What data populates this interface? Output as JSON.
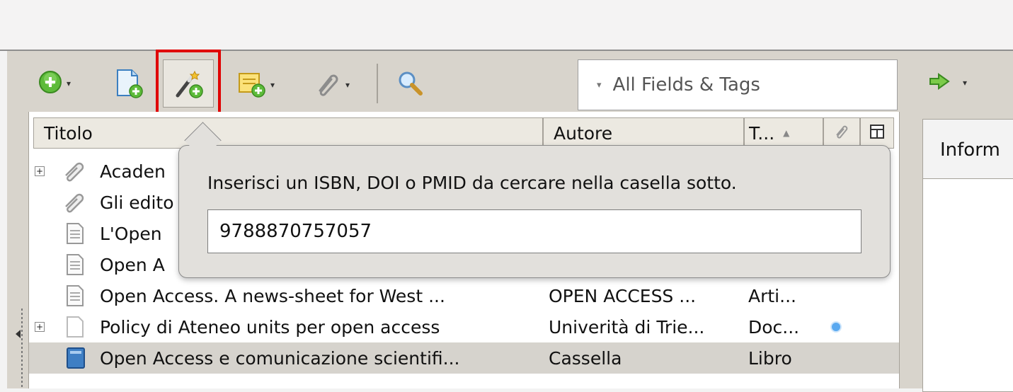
{
  "toolbar": {
    "new_item_icon": "plus-circle-icon",
    "new_item_from_file_icon": "document-add-icon",
    "add_by_identifier_icon": "magic-wand-icon",
    "new_note_icon": "note-add-icon",
    "attachment_icon": "paperclip-icon",
    "search_icon": "magnifier-icon",
    "sync_icon": "arrow-right-icon",
    "dropdown_glyph": "▾",
    "search_placeholder": "All Fields & Tags"
  },
  "columns": {
    "title": "Titolo",
    "author": "Autore",
    "type": "T...",
    "sort_arrow": "▲"
  },
  "rows": [
    {
      "title": "Acaden",
      "author": "",
      "type": "",
      "expand": "+",
      "icon": "attachment-icon"
    },
    {
      "title": "Gli edito",
      "author": "",
      "type": "",
      "expand": "",
      "icon": "attachment-icon"
    },
    {
      "title": "L'Open",
      "author": "",
      "type": "",
      "expand": "",
      "icon": "document-icon"
    },
    {
      "title": "Open A",
      "author": "",
      "type": "",
      "expand": "",
      "icon": "document-icon"
    },
    {
      "title": "Open Access. A news-sheet for West ...",
      "author": "OPEN ACCESS ...",
      "type": "Arti...",
      "expand": "",
      "icon": "document-icon"
    },
    {
      "title": "Policy di Ateneo units per open access",
      "author": "Univerità di Trie...",
      "type": "Doc...",
      "expand": "+",
      "icon": "page-icon",
      "dot": true
    },
    {
      "title": "Open Access e comunicazione scientifi...",
      "author": "Cassella",
      "type": "Libro",
      "expand": "",
      "icon": "book-icon",
      "selected": true
    }
  ],
  "right_pane": {
    "tab_label": "Inform"
  },
  "popup": {
    "message": "Inserisci un ISBN, DOI o PMID da cercare nella casella sotto.",
    "input_value": "9788870757057"
  },
  "colors": {
    "highlight": "#e00000",
    "toolbar_bg": "#d8d4cc",
    "selected_row": "#d6d3cd",
    "green": "#4caf2c"
  }
}
